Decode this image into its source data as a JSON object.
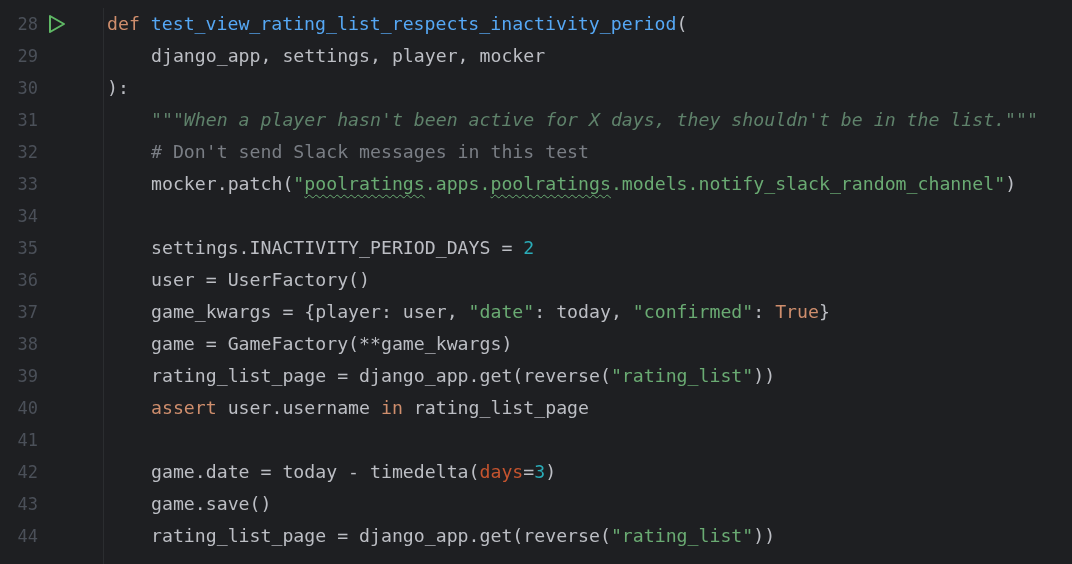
{
  "editor": {
    "lines": [
      {
        "number": "28",
        "run_button": true,
        "tokens": [
          {
            "kind": "keyword",
            "text": "def "
          },
          {
            "kind": "function",
            "text": "test_view_rating_list_respects_inactivity_period"
          },
          {
            "kind": "plain",
            "text": "("
          }
        ],
        "children": [
          {
            "number": "29",
            "tokens": [
              {
                "kind": "plain",
                "text": "django_app, settings, player, mocker"
              }
            ]
          }
        ]
      },
      {
        "number": "30",
        "tokens": [
          {
            "kind": "plain",
            "text": "):"
          }
        ],
        "children": [
          {
            "number": "31",
            "tokens": [
              {
                "kind": "docstring",
                "text": "\"\"\"When a player hasn't been active for X days, they shouldn't be in the list.\"\"\""
              }
            ]
          },
          {
            "number": "32",
            "tokens": [
              {
                "kind": "comment",
                "text": "# Don't send Slack messages in this test"
              }
            ]
          },
          {
            "number": "33",
            "tokens": [
              {
                "kind": "plain",
                "text": "mocker.patch("
              },
              {
                "kind": "string",
                "text": "\""
              },
              {
                "kind": "typo",
                "text": "poolratings"
              },
              {
                "kind": "string",
                "text": ".apps."
              },
              {
                "kind": "typo",
                "text": "poolratings"
              },
              {
                "kind": "string",
                "text": ".models.notify_slack_random_channel\""
              },
              {
                "kind": "plain",
                "text": ")"
              }
            ]
          },
          {
            "number": "34"
          },
          {
            "number": "35",
            "tokens": [
              {
                "kind": "plain",
                "text": "settings.INACTIVITY_PERIOD_DAYS = "
              },
              {
                "kind": "number",
                "text": "2"
              }
            ]
          },
          {
            "number": "36",
            "tokens": [
              {
                "kind": "plain",
                "text": "user = UserFactory()"
              }
            ]
          },
          {
            "number": "37",
            "tokens": [
              {
                "kind": "plain",
                "text": "game_kwargs = {player: user, "
              },
              {
                "kind": "string",
                "text": "\"date\""
              },
              {
                "kind": "plain",
                "text": ": today, "
              },
              {
                "kind": "string",
                "text": "\"confirmed\""
              },
              {
                "kind": "plain",
                "text": ": "
              },
              {
                "kind": "keyword",
                "text": "True"
              },
              {
                "kind": "plain",
                "text": "}"
              }
            ]
          },
          {
            "number": "38",
            "tokens": [
              {
                "kind": "plain",
                "text": "game = GameFactory(**game_kwargs)"
              }
            ]
          },
          {
            "number": "39",
            "tokens": [
              {
                "kind": "plain",
                "text": "rating_list_page = django_app.get(reverse("
              },
              {
                "kind": "string",
                "text": "\"rating_list\""
              },
              {
                "kind": "plain",
                "text": "))"
              }
            ]
          },
          {
            "number": "40",
            "tokens": [
              {
                "kind": "keyword",
                "text": "assert"
              },
              {
                "kind": "plain",
                "text": " user.username "
              },
              {
                "kind": "keyword",
                "text": "in"
              },
              {
                "kind": "plain",
                "text": " rating_list_page"
              }
            ]
          },
          {
            "number": "41"
          },
          {
            "number": "42",
            "tokens": [
              {
                "kind": "plain",
                "text": "game.date = today - timedelta("
              },
              {
                "kind": "parameter",
                "text": "days"
              },
              {
                "kind": "plain",
                "text": "="
              },
              {
                "kind": "number",
                "text": "3"
              },
              {
                "kind": "plain",
                "text": ")"
              }
            ]
          },
          {
            "number": "43",
            "tokens": [
              {
                "kind": "plain",
                "text": "game.save()"
              }
            ]
          },
          {
            "number": "44",
            "tokens": [
              {
                "kind": "plain",
                "text": "rating_list_page = django_app.get(reverse("
              },
              {
                "kind": "string",
                "text": "\"rating_list\""
              },
              {
                "kind": "plain",
                "text": "))"
              }
            ]
          }
        ]
      }
    ]
  }
}
